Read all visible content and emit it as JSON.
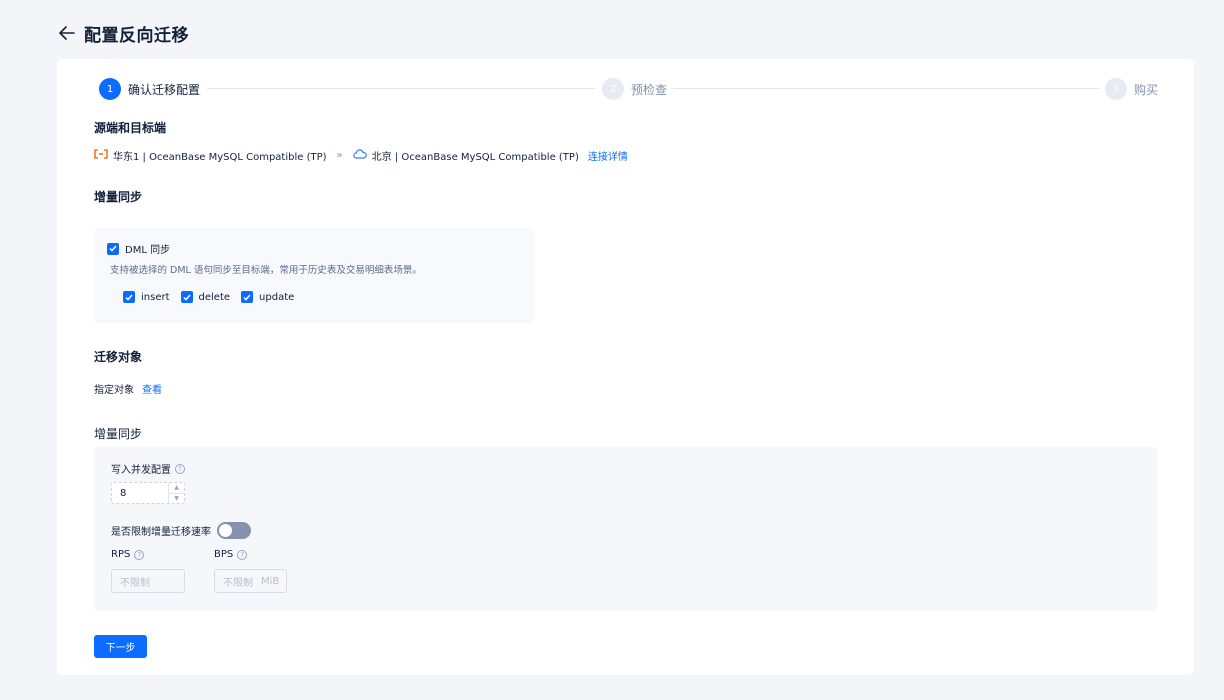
{
  "header": {
    "title": "配置反向迁移"
  },
  "steps": [
    {
      "number": "1",
      "label": "确认迁移配置"
    },
    {
      "number": "2",
      "label": "预检查"
    },
    {
      "number": "3",
      "label": "购买"
    }
  ],
  "source_target": {
    "title": "源端和目标端",
    "source": "华东1 | OceanBase MySQL Compatible (TP)",
    "separator": "»",
    "target": "北京 | OceanBase MySQL Compatible (TP)",
    "detail_link": "连接详情"
  },
  "incremental": {
    "title": "增量同步",
    "dml_label": "DML 同步",
    "dml_desc": "支持被选择的 DML 语句同步至目标端，常用于历史表及交易明细表场景。",
    "ops": [
      "insert",
      "delete",
      "update"
    ]
  },
  "objects": {
    "title": "迁移对象",
    "label": "指定对象",
    "view_link": "查看"
  },
  "incremental_config": {
    "title": "增量同步",
    "concurrency_label": "写入并发配置",
    "concurrency_value": "8",
    "limit_label": "是否限制增量迁移速率",
    "rps_label": "RPS",
    "rps_placeholder": "不限制",
    "bps_label": "BPS",
    "bps_placeholder": "不限制",
    "bps_unit": "MiB"
  },
  "next_button": "下一步",
  "colors": {
    "primary": "#0b6cff",
    "source_icon": "#f5781f",
    "target_icon": "#2f7df7"
  }
}
